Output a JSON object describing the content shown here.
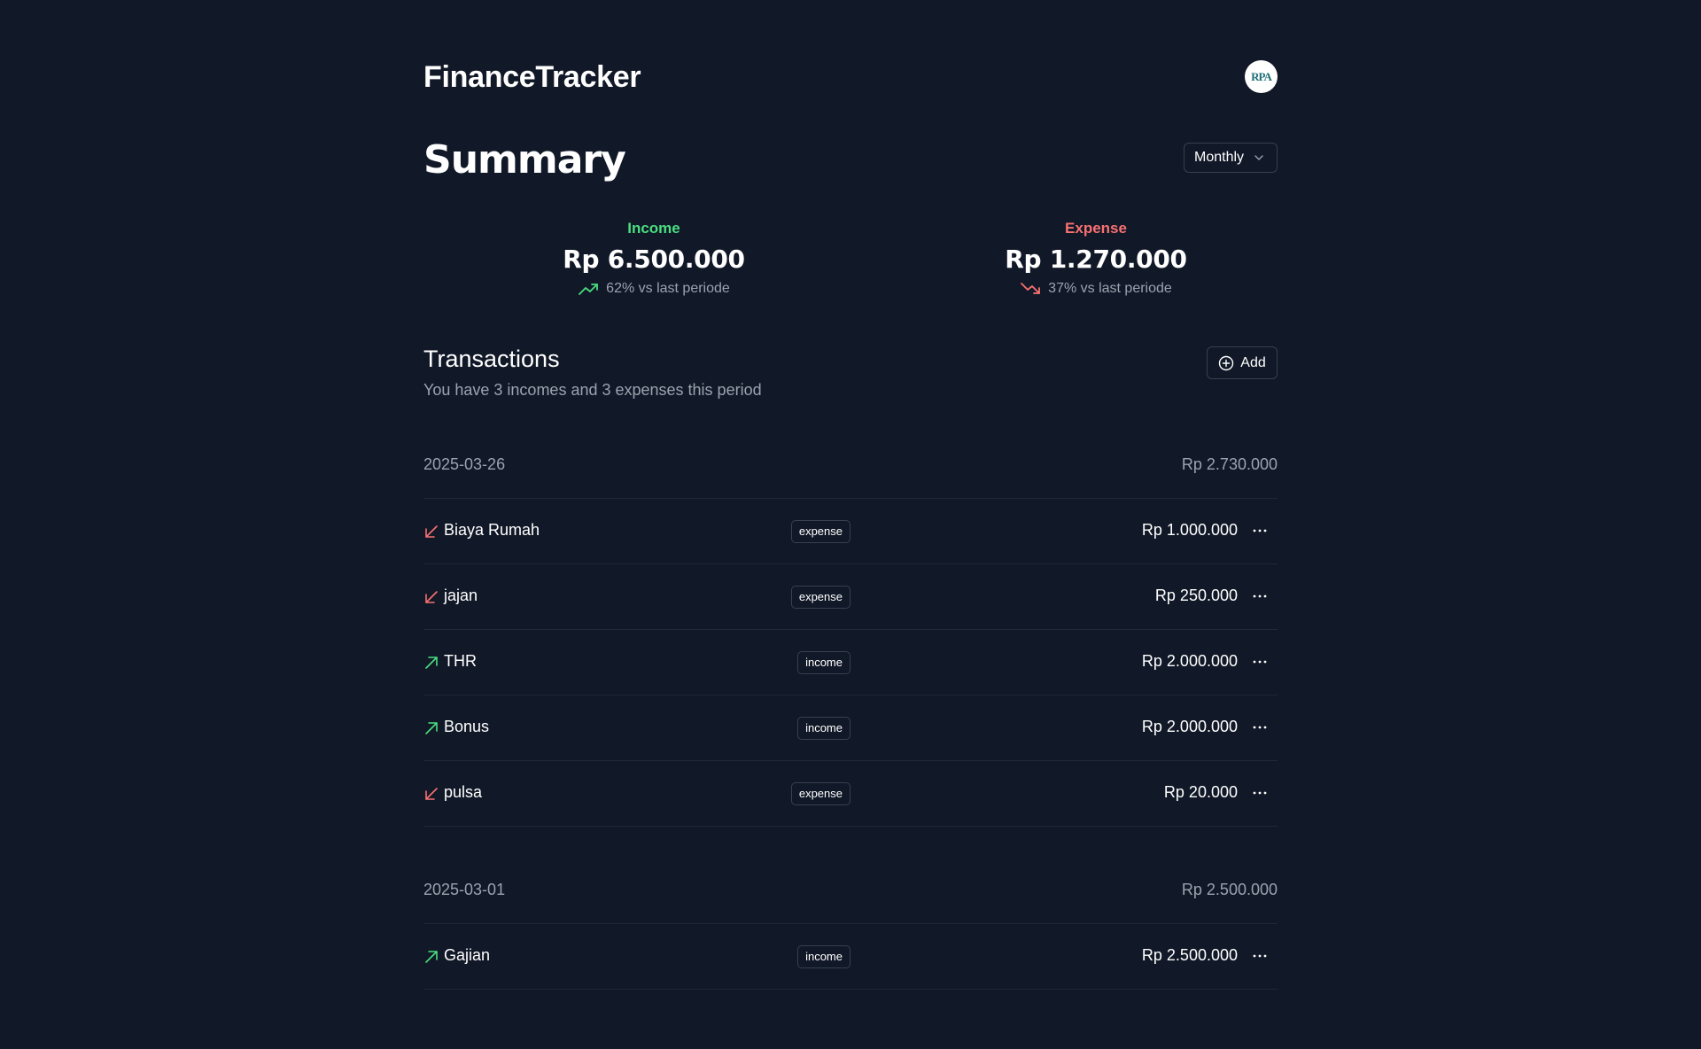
{
  "app": {
    "brand": "FinanceTracker",
    "avatar_text": "RPA"
  },
  "summary": {
    "title": "Summary",
    "period": "Monthly",
    "income": {
      "label": "Income",
      "amount": "Rp 6.500.000",
      "change": "62% vs last periode",
      "color": "#4ade80"
    },
    "expense": {
      "label": "Expense",
      "amount": "Rp 1.270.000",
      "change": "37% vs last periode",
      "color": "#f87171"
    }
  },
  "transactions": {
    "title": "Transactions",
    "subtitle": "You have 3 incomes and 3 expenses this period",
    "add_label": "Add",
    "groups": [
      {
        "date": "2025-03-26",
        "total": "Rp 2.730.000",
        "items": [
          {
            "name": "Biaya Rumah",
            "type": "expense",
            "amount": "Rp 1.000.000"
          },
          {
            "name": "jajan",
            "type": "expense",
            "amount": "Rp 250.000"
          },
          {
            "name": "THR",
            "type": "income",
            "amount": "Rp 2.000.000"
          },
          {
            "name": "Bonus",
            "type": "income",
            "amount": "Rp 2.000.000"
          },
          {
            "name": "pulsa",
            "type": "expense",
            "amount": "Rp 20.000"
          }
        ]
      },
      {
        "date": "2025-03-01",
        "total": "Rp 2.500.000",
        "items": [
          {
            "name": "Gajian",
            "type": "income",
            "amount": "Rp 2.500.000"
          }
        ]
      }
    ]
  },
  "colors": {
    "background": "#111827",
    "income": "#4ade80",
    "expense": "#f87171",
    "border": "#374151"
  },
  "icons": {
    "income_row": "arrow-up-right-icon",
    "expense_row": "arrow-down-left-icon",
    "more": "more-horizontal-icon",
    "add": "plus-circle-icon",
    "select": "chevron-down-icon",
    "trend_up": "trending-up-icon",
    "trend_down": "trending-down-icon"
  }
}
